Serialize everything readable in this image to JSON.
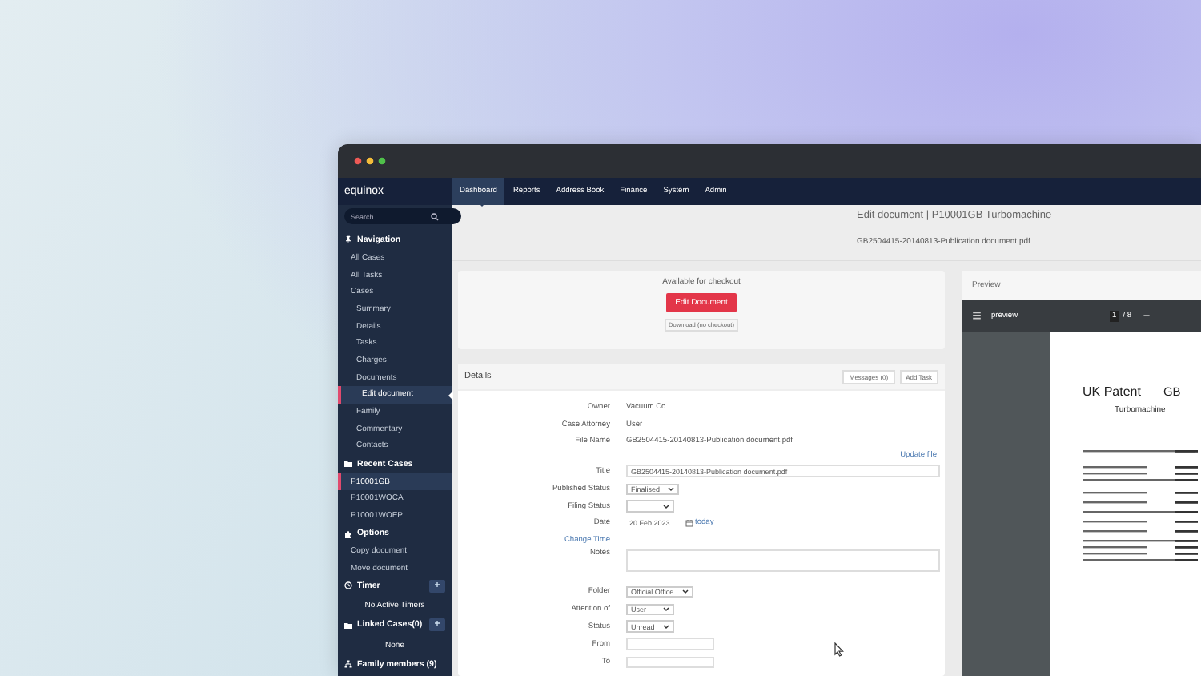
{
  "app": {
    "logo": "equinox"
  },
  "sidebar": {
    "search": {
      "placeholder": "Search"
    },
    "sections": [
      {
        "title": "Navigation",
        "items": [
          {
            "label": "All Cases",
            "selected": false
          },
          {
            "label": "All Tasks",
            "selected": false
          },
          {
            "label": "Cases",
            "selected": false,
            "children": [
              {
                "label": "Summary",
                "selected": false
              },
              {
                "label": "Details",
                "selected": false
              },
              {
                "label": "Tasks",
                "selected": false
              },
              {
                "label": "Charges",
                "selected": false
              },
              {
                "label": "Documents",
                "selected": false,
                "children": [
                  {
                    "label": "Edit document",
                    "selected": true
                  }
                ]
              },
              {
                "label": "Family",
                "selected": false
              },
              {
                "label": "Commentary",
                "selected": false
              },
              {
                "label": "Contacts",
                "selected": false
              }
            ]
          }
        ]
      },
      {
        "title": "Recent Cases",
        "items": [
          {
            "label": "P10001GB",
            "selected": true
          },
          {
            "label": "P10001WOCA",
            "selected": false
          },
          {
            "label": "P10001WOEP",
            "selected": false
          }
        ]
      },
      {
        "title": "Options",
        "items": [
          {
            "label": "Copy document",
            "selected": false
          },
          {
            "label": "Move document",
            "selected": false
          }
        ]
      },
      {
        "title": "Timer",
        "action": "+",
        "message": "No Active Timers"
      },
      {
        "title": "Linked Cases(0)",
        "action": "+",
        "message": "None"
      },
      {
        "title": "Family members (9)"
      }
    ]
  },
  "topnav": [
    {
      "label": "Dashboard",
      "selected": true
    },
    {
      "label": "Reports",
      "selected": false
    },
    {
      "label": "Address Book",
      "selected": false
    },
    {
      "label": "Finance",
      "selected": false
    },
    {
      "label": "System",
      "selected": false
    },
    {
      "label": "Admin",
      "selected": false
    }
  ],
  "header": {
    "title": "Edit document | P10001GB Turbomachine",
    "subtitle": "GB2504415-20140813-Publication document.pdf"
  },
  "checkout": {
    "status": "Available for checkout",
    "primary_button": "Edit Document",
    "secondary_button": "Download (no checkout)"
  },
  "details": {
    "title": "Details",
    "buttons": [
      "Messages (0)",
      "Add Task"
    ],
    "rows": [
      {
        "kind": "text",
        "label": "Owner",
        "value": "Vacuum Co."
      },
      {
        "kind": "text",
        "label": "Case Attorney",
        "value": "User"
      },
      {
        "kind": "text",
        "label": "File Name",
        "value": "GB2504415-20140813-Publication document.pdf",
        "link": "Update file"
      },
      {
        "kind": "input",
        "label": "Title",
        "value": "GB2504415-20140813-Publication document.pdf"
      },
      {
        "kind": "select",
        "label": "Published Status",
        "value": "Finalised"
      },
      {
        "kind": "select",
        "label": "Filing Status"
      },
      {
        "kind": "date",
        "label": "Date",
        "value": "20 Feb 2023",
        "link": "today"
      },
      {
        "kind": "link",
        "label": "Change Time"
      },
      {
        "kind": "textarea",
        "label": "Notes"
      },
      {
        "kind": "select",
        "label": "Folder",
        "value": "Official Office"
      },
      {
        "kind": "select",
        "label": "Attention of",
        "value": "User"
      },
      {
        "kind": "select",
        "label": "Status",
        "value": "Unread"
      },
      {
        "kind": "input",
        "label": "From"
      },
      {
        "kind": "input",
        "label": "To"
      }
    ]
  },
  "preview": {
    "title": "Preview",
    "toolbar": {
      "document_name": "preview",
      "page": "1",
      "page_count": "/ 8"
    },
    "page": {
      "heading": "UK Patent",
      "country": "GB",
      "invention_title": "Turbomachine"
    }
  }
}
